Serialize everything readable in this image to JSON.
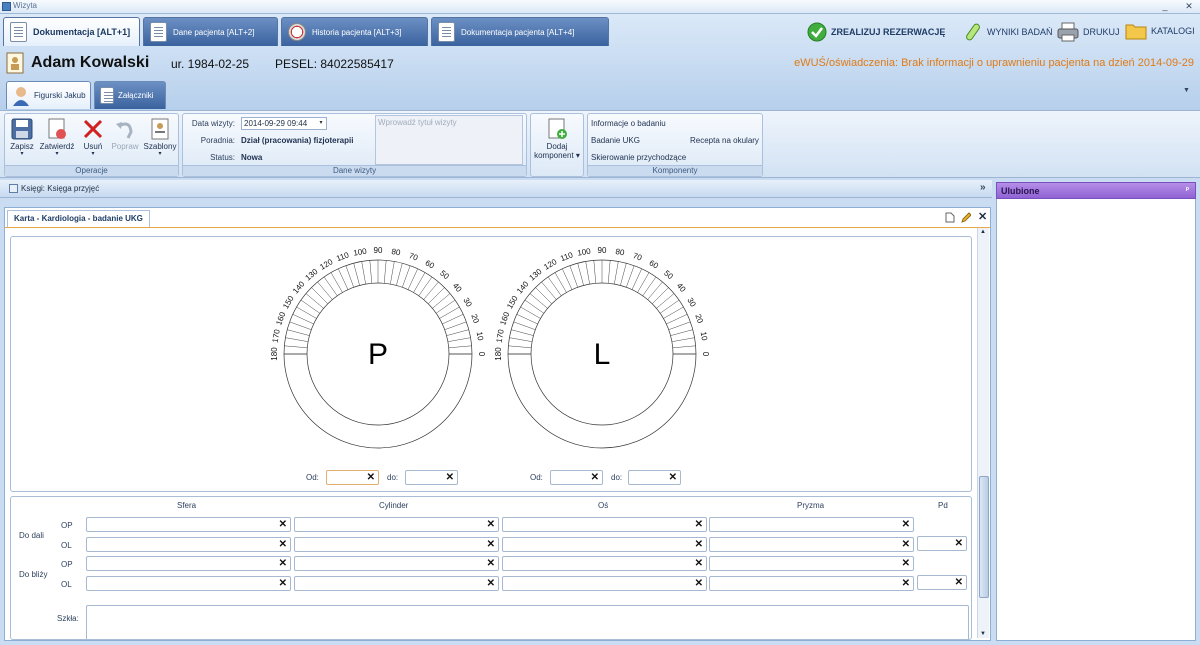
{
  "window": {
    "title": "Wizyta",
    "min": "_",
    "close": "✕"
  },
  "main_tabs": [
    {
      "label": "Dokumentacja [ALT+1]"
    },
    {
      "label": "Dane pacjenta [ALT+2]"
    },
    {
      "label": "Historia pacjenta [ALT+3]"
    },
    {
      "label": "Dokumentacja pacjenta [ALT+4]"
    }
  ],
  "top_actions": {
    "realize": "ZREALIZUJ REZERWACJĘ",
    "results": "WYNIKI BADAŃ",
    "print": "DRUKUJ",
    "catalogs": "KATALOGI"
  },
  "patient": {
    "name": "Adam Kowalski",
    "born": "ur. 1984-02-25",
    "pesel": "PESEL: 84022585417",
    "ewus": "eWUŚ/oświadczenia: Brak informacji o uprawnieniu pacjenta na dzień 2014-09-29"
  },
  "sub_tabs": [
    {
      "label": "Figurski Jakub"
    },
    {
      "label": "Załączniki"
    }
  ],
  "ribbon": {
    "operations": {
      "label": "Operacje",
      "save": "Zapisz",
      "approve": "Zatwierdź",
      "delete": "Usuń",
      "fix": "Popraw",
      "templates": "Szablony"
    },
    "visit": {
      "label": "Dane wizyty",
      "date_label": "Data wizyty:",
      "date_value": "2014-09-29 09:44",
      "clinic_label": "Poradnia:",
      "clinic_value": "Dział (pracowania) fizjoterapii",
      "status_label": "Status:",
      "status_value": "Nowa",
      "title_placeholder": "Wprowadź tytuł wizyty"
    },
    "add_component": {
      "line1": "Dodaj",
      "line2": "komponent"
    },
    "components": {
      "label": "Komponenty",
      "info": "Informacje o badaniu",
      "ukg": "Badanie UKG",
      "glasses": "Recepta na okulary",
      "referral": "Skierowanie przychodzące"
    }
  },
  "books": {
    "label": "Księgi: Księga przyjęć"
  },
  "doc_tab": {
    "label": "Karta - Kardiologia - badanie UKG"
  },
  "diagram": {
    "ticks": [
      "180",
      "170",
      "160",
      "150",
      "140",
      "130",
      "120",
      "110",
      "100",
      "90",
      "80",
      "70",
      "60",
      "50",
      "40",
      "30",
      "20",
      "10",
      "0"
    ],
    "right_eye": "P",
    "left_eye": "L"
  },
  "range": {
    "from": "Od:",
    "to": "do:"
  },
  "glasses": {
    "cols": {
      "sphere": "Sfera",
      "cylinder": "Cylinder",
      "axis": "Oś",
      "prism": "Pryzma",
      "pd": "Pd"
    },
    "far": "Do dali",
    "near": "Do bliży",
    "op": "OP",
    "ol": "OL",
    "lenses": "Szkła:"
  },
  "favorites": {
    "label": "Ulubione",
    "pin": "ᵖ"
  }
}
